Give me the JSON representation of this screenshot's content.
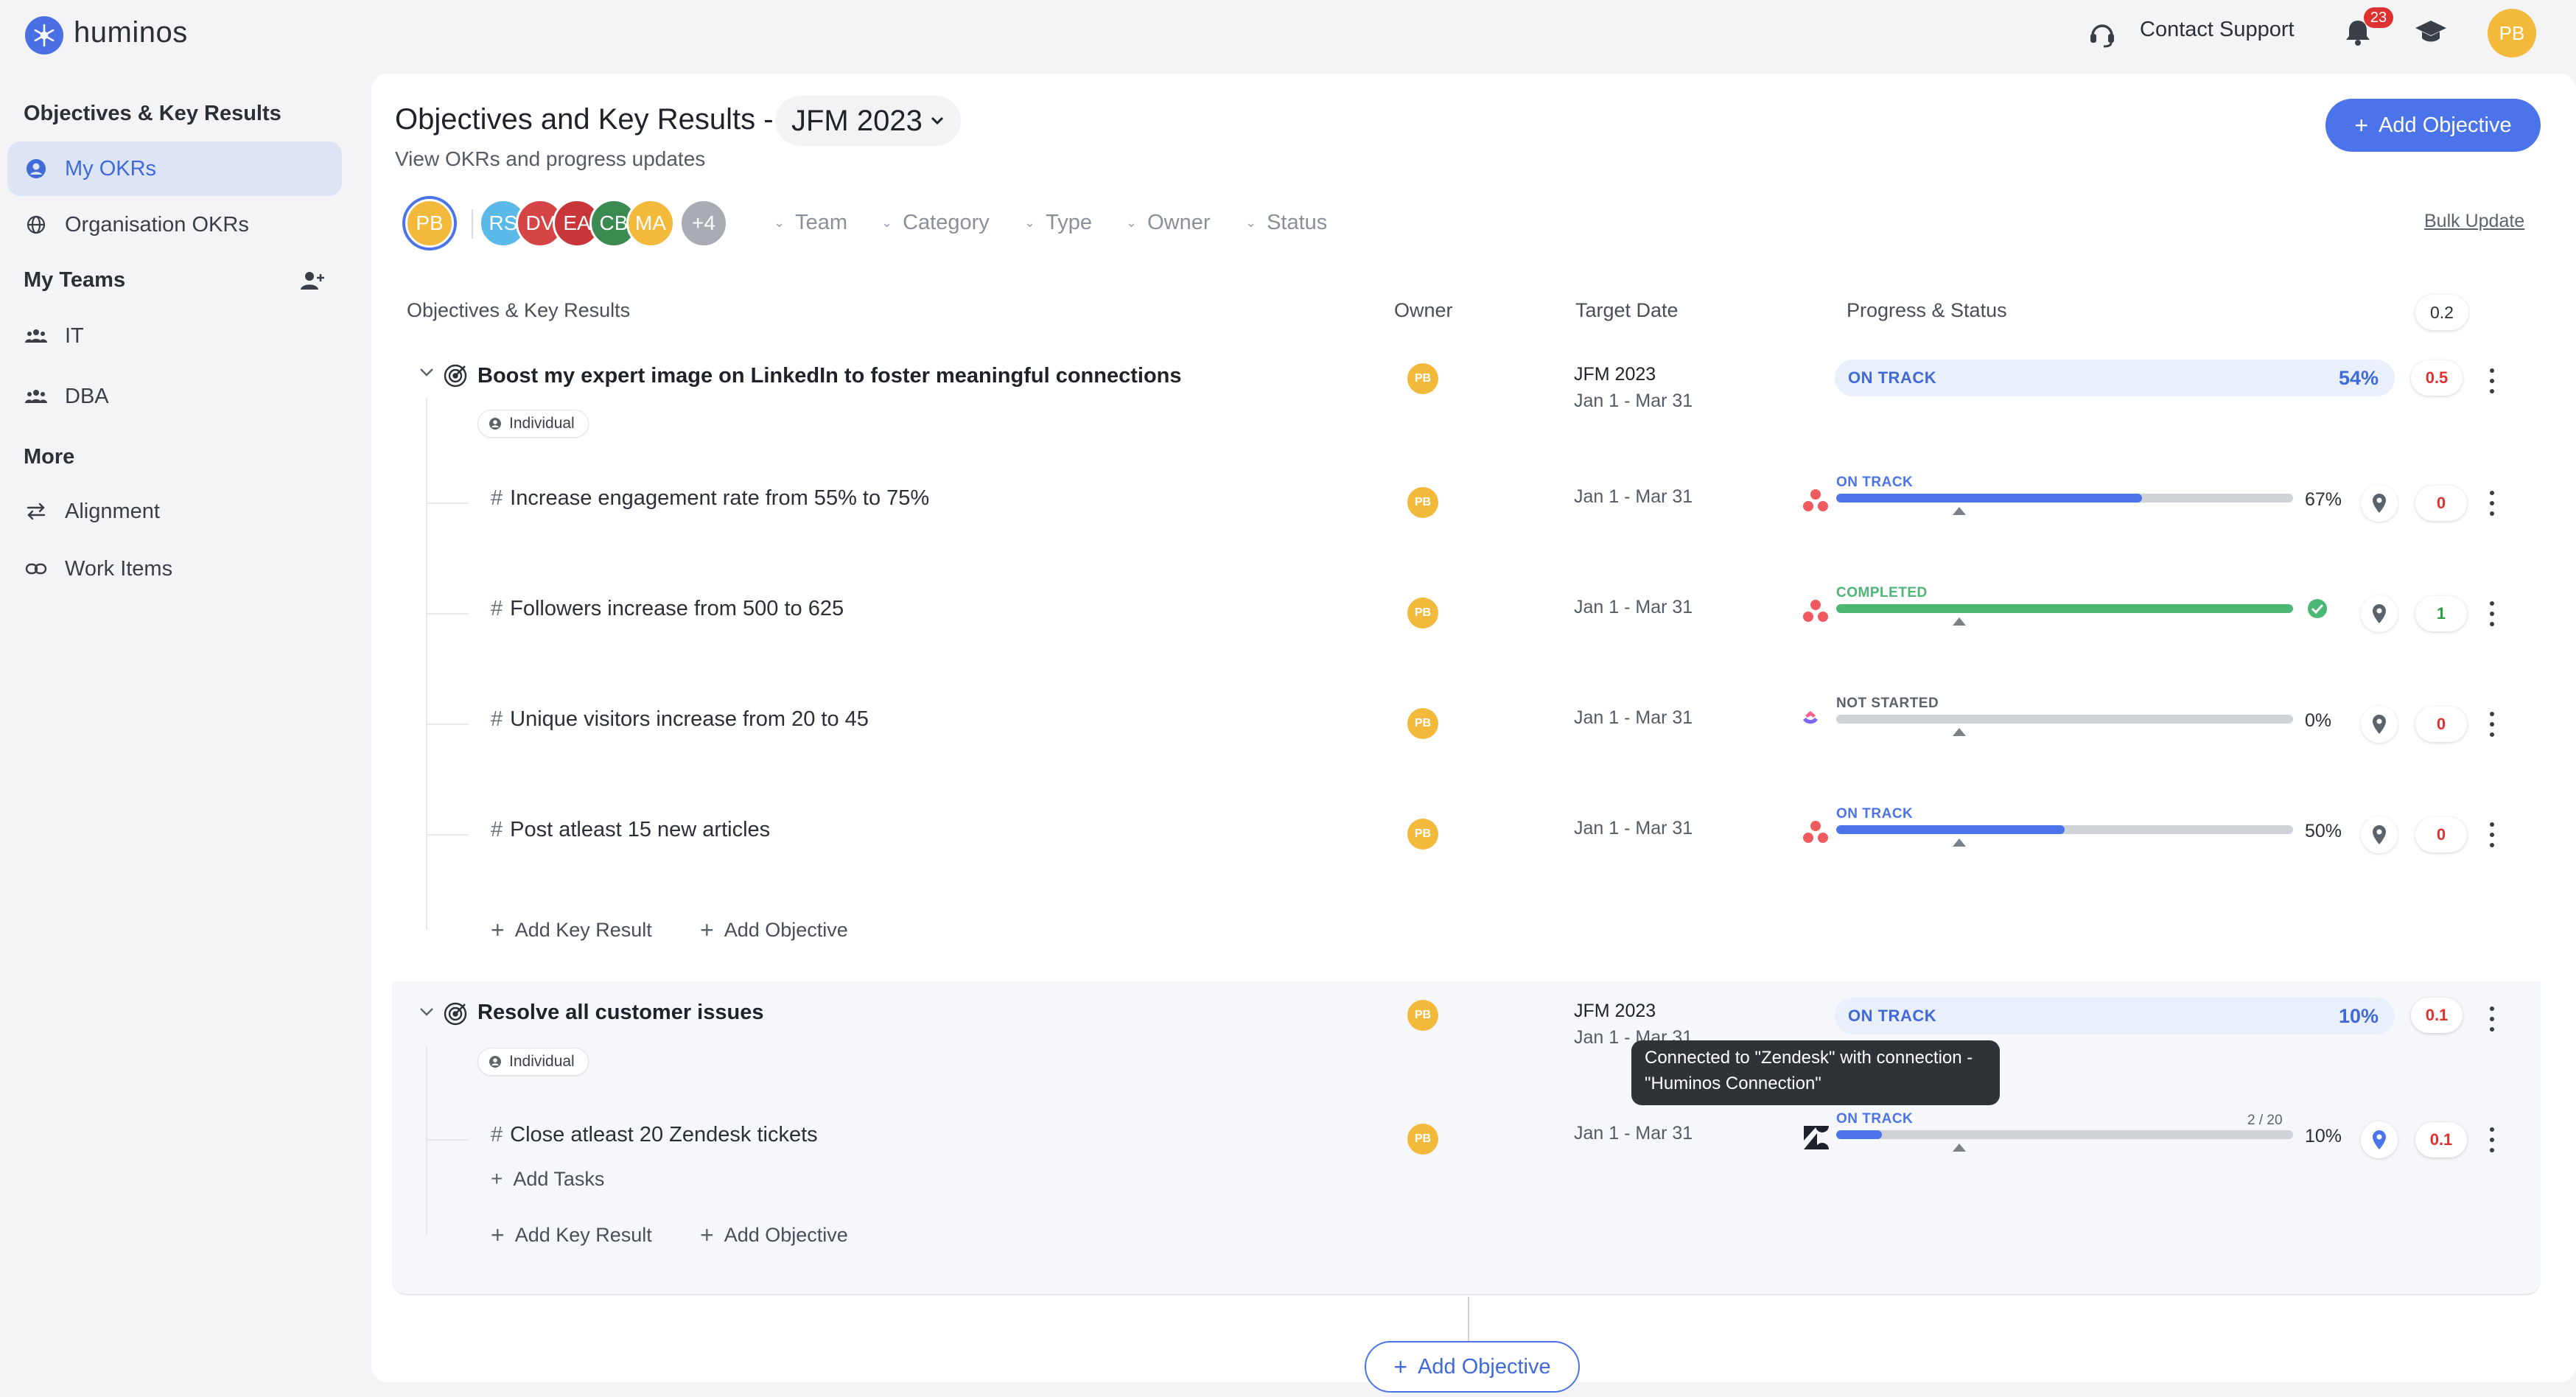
{
  "app": {
    "name": "huminos",
    "support_label": "Contact Support",
    "notification_count": "23",
    "user_initials": "PB"
  },
  "sidebar": {
    "section_okrs": "Objectives & Key Results",
    "my_okrs": "My OKRs",
    "org_okrs": "Organisation OKRs",
    "section_teams": "My Teams",
    "team_it": "IT",
    "team_dba": "DBA",
    "section_more": "More",
    "alignment": "Alignment",
    "work_items": "Work Items"
  },
  "header": {
    "title": "Objectives and Key Results -",
    "cycle": "JFM 2023",
    "subtitle": "View OKRs and progress updates",
    "add_objective": "Add Objective",
    "bulk_update": "Bulk Update"
  },
  "people": {
    "selected": "PB",
    "others": [
      "RS",
      "DV",
      "EA",
      "CB",
      "MA"
    ],
    "more": "+4"
  },
  "filters": [
    "Team",
    "Category",
    "Type",
    "Owner",
    "Status"
  ],
  "columns": {
    "objective": "Objectives & Key Results",
    "owner": "Owner",
    "target": "Target Date",
    "progress": "Progress & Status",
    "score_header": "0.2"
  },
  "objectives": [
    {
      "title": "Boost my expert image on LinkedIn to foster meaningful connections",
      "tag": "Individual",
      "owner": "PB",
      "cycle": "JFM 2023",
      "dates": "Jan 1 - Mar 31",
      "status": "ON TRACK",
      "percent": "54%",
      "score": "0.5",
      "key_results": [
        {
          "title": "Increase engagement rate from 55% to 75%",
          "owner": "PB",
          "dates": "Jan 1 - Mar 31",
          "status": "ON TRACK",
          "progress": 0.67,
          "percent": "67%",
          "score": "0"
        },
        {
          "title": "Followers increase from 500 to 625",
          "owner": "PB",
          "dates": "Jan 1 - Mar 31",
          "status": "COMPLETED",
          "progress": 1.0,
          "percent": "",
          "score": "1"
        },
        {
          "title": "Unique visitors increase from 20 to 45",
          "owner": "PB",
          "dates": "Jan 1 - Mar 31",
          "status": "NOT STARTED",
          "progress": 0.0,
          "percent": "0%",
          "score": "0"
        },
        {
          "title": "Post atleast 15 new articles",
          "owner": "PB",
          "dates": "Jan 1 - Mar 31",
          "status": "ON TRACK",
          "progress": 0.5,
          "percent": "50%",
          "score": "0"
        }
      ],
      "add_key_result": "Add Key Result",
      "add_objective": "Add Objective"
    },
    {
      "title": "Resolve all customer issues",
      "tag": "Individual",
      "owner": "PB",
      "cycle": "JFM 2023",
      "dates": "Jan 1 - Mar 31",
      "status": "ON TRACK",
      "percent": "10%",
      "score": "0.1",
      "key_results": [
        {
          "title": "Close atleast 20 Zendesk tickets",
          "owner": "PB",
          "dates": "Jan 1 - Mar 31",
          "status": "ON TRACK",
          "progress": 0.1,
          "percent": "10%",
          "score": "0.1",
          "count": "2 / 20",
          "add_tasks": "Add Tasks"
        }
      ],
      "add_key_result": "Add Key Result",
      "add_objective": "Add Objective"
    }
  ],
  "tooltip": "Connected to \"Zendesk\" with connection - \"Huminos Connection\"",
  "bottom_add_objective": "Add Objective",
  "colors": {
    "primary": "#4b74ea",
    "on_track": "#4b74ea",
    "completed": "#4cb774",
    "not_started": "#5d636b",
    "score_red": "#e03131",
    "score_green": "#2f9e44"
  }
}
